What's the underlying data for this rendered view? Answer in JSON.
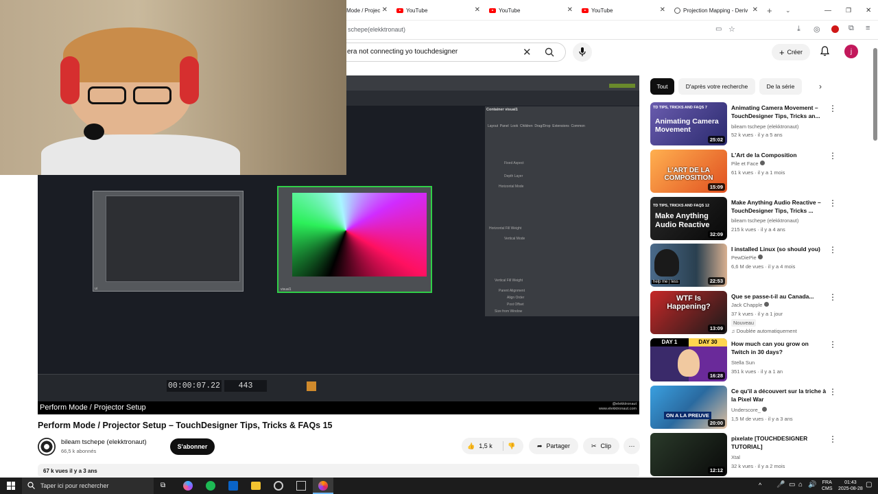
{
  "browser": {
    "tabs": [
      {
        "label": "Mode / Projec",
        "icon": "youtube-icon"
      },
      {
        "label": "YouTube",
        "icon": "youtube-icon"
      },
      {
        "label": "YouTube",
        "icon": "youtube-icon"
      },
      {
        "label": "YouTube",
        "icon": "youtube-icon"
      },
      {
        "label": "Projection Mapping - Deriv",
        "icon": "globe-icon"
      }
    ],
    "url_fragment": "schepe(elekktronaut)"
  },
  "youtube": {
    "search_value": "era not connecting yo touchdesigner",
    "create_label": "Créer",
    "avatar_letter": "j",
    "accent_color": "#ff0000"
  },
  "player": {
    "caption": "Perform Mode / Projector Setup",
    "timecode": "00:00:07.22",
    "frame": "443",
    "watermark_line1": "@elekktronaut",
    "watermark_line2": "www.elekktronaut.com",
    "panel_title": "Container  visual1",
    "panel_tabs": [
      "Layout",
      "Panel",
      "Look",
      "Children",
      "Drag/Drop",
      "Extensions",
      "Common"
    ],
    "panel_params": [
      "Fixed Aspect",
      "Depth Layer",
      "Horizontal Mode",
      "Horizontal Fill Weight",
      "Vertical Mode",
      "Vertical Fill Weight",
      "Parent Alignment",
      "Align Order",
      "Post Offset",
      "Size from Window"
    ],
    "node_left_label": "ui",
    "node_right_label": "visual1"
  },
  "video": {
    "title": "Perform Mode / Projector Setup – TouchDesigner Tips, Tricks & FAQs 15",
    "channel_name": "bileam tschepe (elekktronaut)",
    "subscribers": "66,5 k abonnés",
    "subscribe_label": "S'abonner",
    "likes": "1,5 k",
    "share_label": "Partager",
    "clip_label": "Clip",
    "views_date": "67 k vues  il y a 3 ans"
  },
  "chips": [
    "Tout",
    "D'après votre recherche",
    "De la série"
  ],
  "recommendations": [
    {
      "title": "Animating Camera Movement – TouchDesigner Tips, Tricks an...",
      "channel": "bileam tschepe (elekktronaut)",
      "stats": "52 k vues · il y a 5 ans",
      "duration": "25:02",
      "thumb_text": "Animating Camera Movement",
      "thumb_tag": "TD TIPS, TRICKS AND FAQS 7",
      "verified": false
    },
    {
      "title": "L'Art de la Composition",
      "channel": "Pile et Face",
      "stats": "61 k vues · il y a 1 mois",
      "duration": "15:09",
      "thumb_text": "L'ART DE LA COMPOSITION",
      "verified": true
    },
    {
      "title": "Make Anything Audio Reactive – TouchDesigner Tips, Tricks ...",
      "channel": "bileam tschepe (elekktronaut)",
      "stats": "215 k vues · il y a 4 ans",
      "duration": "32:09",
      "thumb_text": "Make Anything Audio Reactive",
      "thumb_tag": "TD TIPS, TRICKS AND FAQS 12",
      "verified": false
    },
    {
      "title": "I installed Linux (so should you)",
      "channel": "PewDiePie",
      "stats": "6,6 M de vues · il y a 4 mois",
      "duration": "22:53",
      "thumb_text": "help me | less",
      "verified": true
    },
    {
      "title": "Que se passe-t-il au Canada...",
      "channel": "Jack Chapple",
      "stats": "37 k vues · il y a 1 jour",
      "duration": "13:09",
      "thumb_text": "WTF Is Happening?",
      "badge_new": "Nouveau",
      "badge_dub": "Doublée automatiquement",
      "verified": true
    },
    {
      "title": "How much can you grow on Twitch in 30 days?",
      "channel": "Stella Sun",
      "stats": "351 k vues · il y a 1 an",
      "duration": "16:28",
      "thumb_day1": "DAY 1",
      "thumb_day30": "DAY 30",
      "verified": false
    },
    {
      "title": "Ce qu'il a découvert sur la triche à la Pixel War",
      "channel": "Underscore_",
      "stats": "1,5 M de vues · il y a 3 ans",
      "duration": "20:00",
      "thumb_text": "ON A LA PREUVE",
      "verified": true
    },
    {
      "title": "pixelate [TOUCHDESIGNER TUTORIAL]",
      "channel": "Xtal",
      "stats": "32 k vues · il y a 2 mois",
      "duration": "12:12",
      "verified": false
    }
  ],
  "taskbar": {
    "search_placeholder": "Taper ici pour rechercher",
    "lang_line1": "FRA",
    "lang_line2": "CMS",
    "time": "01:43",
    "date": "2025-08-28"
  }
}
